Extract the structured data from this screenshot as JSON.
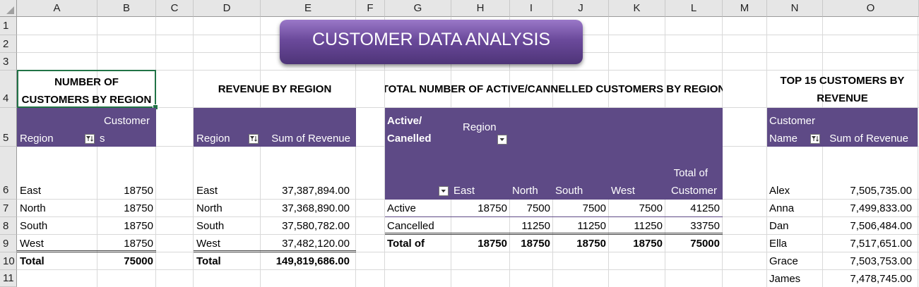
{
  "spreadsheet": {
    "column_headers": [
      "A",
      "B",
      "C",
      "D",
      "E",
      "F",
      "G",
      "H",
      "I",
      "J",
      "K",
      "L",
      "M",
      "N",
      "O"
    ],
    "row_headers": [
      "1",
      "2",
      "3",
      "4",
      "5",
      "6",
      "7",
      "8",
      "9",
      "10",
      "11"
    ]
  },
  "title": "CUSTOMER DATA ANALYSIS",
  "customers_by_region": {
    "heading": "NUMBER OF CUSTOMERS BY REGION",
    "heading_line1": "NUMBER OF",
    "heading_line2": "CUSTOMERS BY REGION",
    "col_region": "Region",
    "col_customers_line1": "Customer",
    "col_customers_line2": "s",
    "rows": [
      {
        "region": "East",
        "customers": "18750"
      },
      {
        "region": "North",
        "customers": "18750"
      },
      {
        "region": "South",
        "customers": "18750"
      },
      {
        "region": "West",
        "customers": "18750"
      }
    ],
    "total_label": "Total",
    "total_value": "75000"
  },
  "revenue_by_region": {
    "heading": "REVENUE BY REGION",
    "col_region": "Region",
    "col_revenue": "Sum of Revenue",
    "rows": [
      {
        "region": "East",
        "revenue": "37,387,894.00"
      },
      {
        "region": "North",
        "revenue": "37,368,890.00"
      },
      {
        "region": "South",
        "revenue": "37,580,782.00"
      },
      {
        "region": "West",
        "revenue": "37,482,120.00"
      }
    ],
    "total_label": "Total",
    "total_value": "149,819,686.00"
  },
  "active_cancelled": {
    "heading": "TOTAL NUMBER OF ACTIVE/CANNELLED CUSTOMERS BY REGION",
    "col_status_line1": "Active/",
    "col_status_line2": "Canelled",
    "col_region": "Region",
    "regions": [
      "East",
      "North",
      "South",
      "West"
    ],
    "col_total_line1": "Total of",
    "col_total_line2": "Customer",
    "rows": [
      {
        "status": "Active",
        "values": [
          "18750",
          "7500",
          "7500",
          "7500"
        ],
        "total": "41250"
      },
      {
        "status": "Cancelled",
        "values": [
          "",
          "11250",
          "11250",
          "11250"
        ],
        "total": "33750"
      }
    ],
    "total_label": "Total of",
    "total_values": [
      "18750",
      "18750",
      "18750",
      "18750"
    ],
    "grand_total": "75000"
  },
  "top_customers": {
    "heading_line1": "TOP 15 CUSTOMERS BY",
    "heading_line2": "REVENUE",
    "col_name_line1": "Customer",
    "col_name_line2": "Name",
    "col_revenue": "Sum of Revenue",
    "rows": [
      {
        "name": "Alex",
        "revenue": "7,505,735.00"
      },
      {
        "name": "Anna",
        "revenue": "7,499,833.00"
      },
      {
        "name": "Dan",
        "revenue": "7,506,484.00"
      },
      {
        "name": "Ella",
        "revenue": "7,517,651.00"
      },
      {
        "name": "Grace",
        "revenue": "7,503,753.00"
      },
      {
        "name": "James",
        "revenue": "7,478,745.00"
      }
    ]
  },
  "colors": {
    "header_purple": "#5e4a86",
    "banner_purple": "#6b4a9b",
    "selection_green": "#217346"
  }
}
